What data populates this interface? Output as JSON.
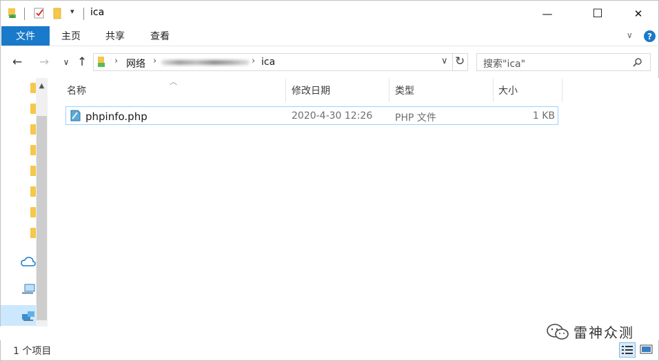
{
  "window": {
    "title": "ica",
    "minimize_glyph": "—",
    "maximize_glyph": "☐",
    "close_glyph": "✕",
    "quick_access_dropdown": "▾"
  },
  "ribbon": {
    "tabs": [
      "文件",
      "主页",
      "共享",
      "查看"
    ],
    "help": "?",
    "expand_glyph": "∨"
  },
  "nav": {
    "back": "←",
    "forward": "→",
    "recent": "∨",
    "up": "↑",
    "breadcrumbs": [
      "网络",
      "ica"
    ],
    "crumb_sep": "›",
    "dropdown": "∨",
    "refresh": "↻"
  },
  "search": {
    "placeholder": "搜索\"ica\"",
    "icon": "search-icon"
  },
  "columns": [
    "名称",
    "修改日期",
    "类型",
    "大小"
  ],
  "files": [
    {
      "name": "phpinfo.php",
      "modified": "2020-4-30 12:26",
      "type": "PHP 文件",
      "size": "1 KB"
    }
  ],
  "status": {
    "item_count": "1 个项目"
  },
  "watermark": {
    "text": "雷神众测"
  },
  "colors": {
    "accent": "#1979ca",
    "selection_border": "#99d1ff",
    "folder": "#f5c84b"
  }
}
